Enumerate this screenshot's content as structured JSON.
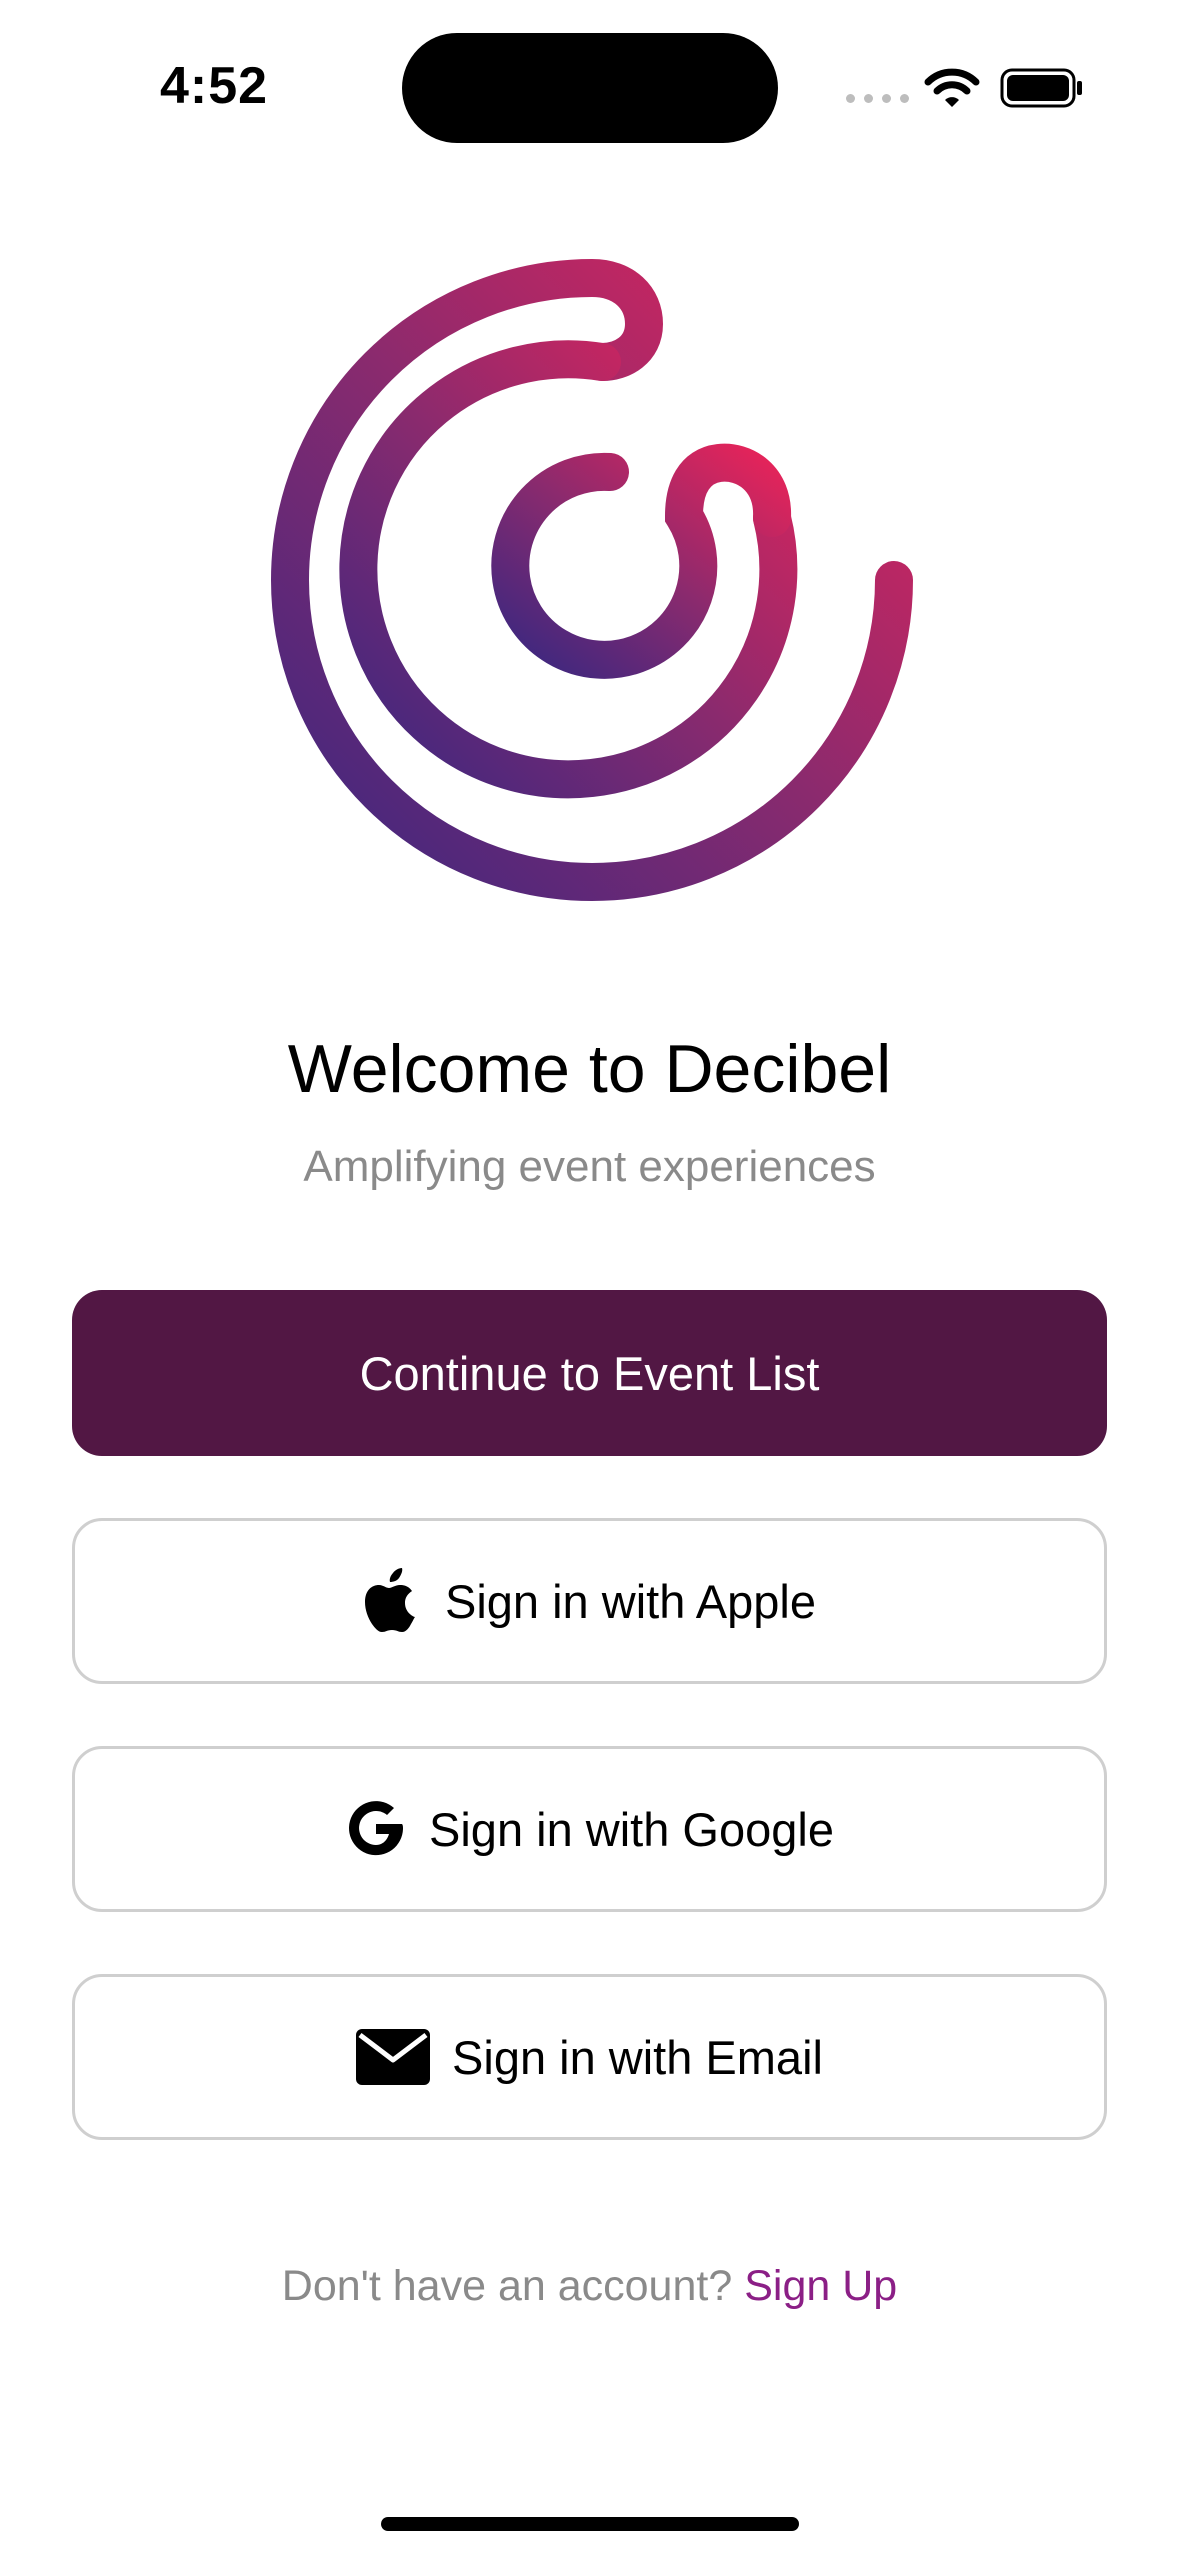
{
  "status_bar": {
    "time": "4:52",
    "icons": [
      "cellular-signal-icon",
      "wifi-icon",
      "battery-icon"
    ]
  },
  "brand": {
    "logo": "decibel-spiral-logo",
    "gradient_colors": [
      "#e4245a",
      "#44287e"
    ]
  },
  "welcome": {
    "title": "Welcome to Decibel",
    "subtitle": "Amplifying event experiences"
  },
  "buttons": {
    "continue_label": "Continue to Event List",
    "apple_label": "Sign in with Apple",
    "google_label": "Sign in with Google",
    "email_label": "Sign in with Email"
  },
  "footer": {
    "prompt": "Don't have an account?",
    "signup_label": "Sign Up"
  },
  "colors": {
    "primary": "#521744",
    "link": "#8b1f86",
    "muted_text": "#8a8a8a",
    "outline": "#cfcfcf"
  }
}
